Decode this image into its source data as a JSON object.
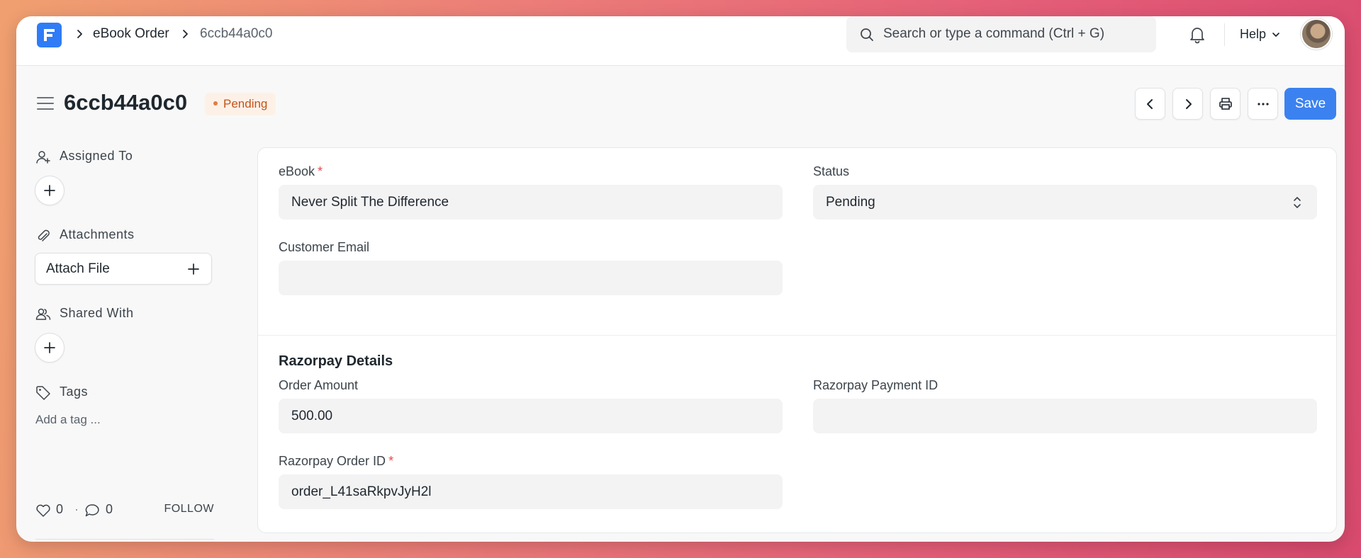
{
  "navbar": {
    "breadcrumbs": [
      "eBook Order",
      "6ccb44a0c0"
    ],
    "search_placeholder": "Search or type a command (Ctrl + G)",
    "help_label": "Help"
  },
  "page": {
    "title": "6ccb44a0c0",
    "status": "Pending",
    "save_label": "Save"
  },
  "sidebar": {
    "assigned_to": "Assigned To",
    "attachments": "Attachments",
    "attach_file": "Attach File",
    "shared_with": "Shared With",
    "tags": "Tags",
    "add_tag": "Add a tag ...",
    "likes": "0",
    "separator": "·",
    "comments": "0",
    "follow": "FOLLOW"
  },
  "form": {
    "ebook": {
      "label": "eBook",
      "value": "Never Split The Difference",
      "required": true
    },
    "status": {
      "label": "Status",
      "value": "Pending"
    },
    "customer_email": {
      "label": "Customer Email",
      "value": ""
    },
    "section_title": "Razorpay Details",
    "order_amount": {
      "label": "Order Amount",
      "value": "500.00"
    },
    "payment_id": {
      "label": "Razorpay Payment ID",
      "value": ""
    },
    "order_id": {
      "label": "Razorpay Order ID",
      "value": "order_L41saRkpvJyH2l",
      "required": true
    },
    "required_mark": "*"
  },
  "colors": {
    "primary": "#3b82f0",
    "status_pending_text": "#c4531a",
    "status_pending_bg": "#fdf1e7"
  }
}
